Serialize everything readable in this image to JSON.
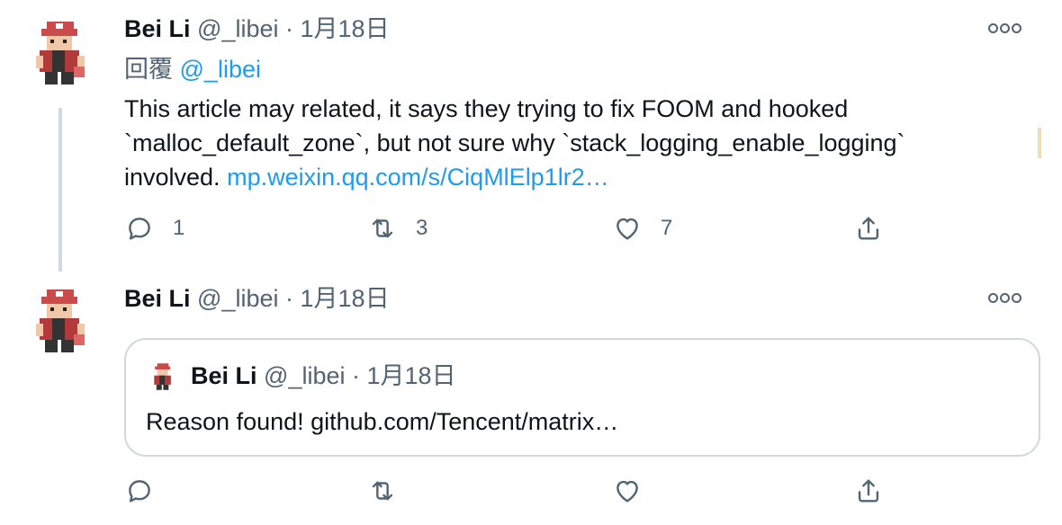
{
  "tweets": [
    {
      "author": {
        "name": "Bei Li",
        "handle": "@_libei"
      },
      "separator": "·",
      "date": "1月18日",
      "reply_prefix": "回覆",
      "reply_to": "@_libei",
      "text_lines": [
        "This article may related, it says they trying to fix FOOM and hooked",
        "`malloc_default_zone`, but not sure why `stack_logging_enable_logging`",
        "involved."
      ],
      "link": "mp.weixin.qq.com/s/CiqMlElp1lr2…",
      "counts": {
        "reply": "1",
        "retweet": "3",
        "like": "7"
      }
    },
    {
      "author": {
        "name": "Bei Li",
        "handle": "@_libei"
      },
      "separator": "·",
      "date": "1月18日",
      "quoted": {
        "author": {
          "name": "Bei Li",
          "handle": "@_libei"
        },
        "separator": "·",
        "date": "1月18日",
        "text": "Reason found! github.com/Tencent/matrix…"
      }
    }
  ],
  "icons": {
    "more": "more-options-icon",
    "reply": "reply-icon",
    "retweet": "retweet-icon",
    "like": "heart-icon",
    "share": "share-icon"
  },
  "colors": {
    "link": "#1d9bf0",
    "secondary": "#536471",
    "text": "#0f1419",
    "border": "#cfd9de"
  }
}
